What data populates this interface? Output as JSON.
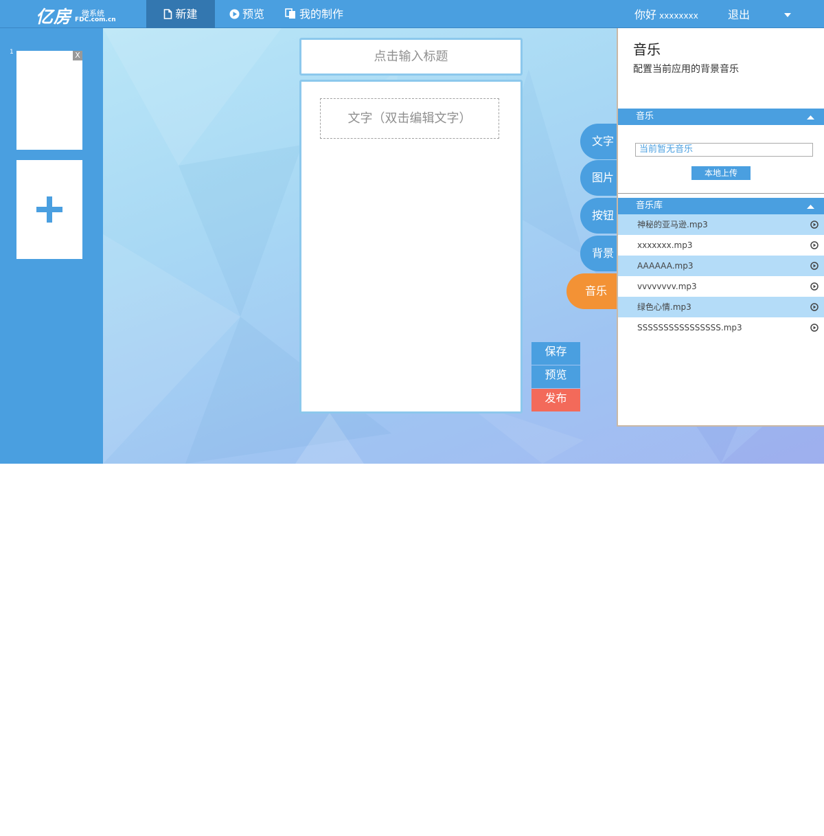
{
  "header": {
    "logo_brand": "亿房",
    "logo_sub": "微系统",
    "logo_domain": "FDC.com.cn",
    "nav": {
      "new": "新建",
      "preview": "预览",
      "mine": "我的制作"
    },
    "greeting": "你好",
    "username": "xxxxxxxx",
    "logout": "退出"
  },
  "pages": {
    "items": [
      {
        "number": "1",
        "close": "X"
      }
    ]
  },
  "editor": {
    "title_placeholder": "点击输入标题",
    "text_element": "文字（双击编辑文字）"
  },
  "tools": {
    "text": "文字",
    "image": "图片",
    "button": "按钮",
    "background": "背景",
    "music": "音乐"
  },
  "actions": {
    "save": "保存",
    "preview": "预览",
    "publish": "发布"
  },
  "panel": {
    "title": "音乐",
    "description": "配置当前应用的背景音乐",
    "music_section": "音乐",
    "current_music": "当前暂无音乐",
    "upload": "本地上传",
    "library_section": "音乐库",
    "library": [
      "神秘的亚马逊.mp3",
      "xxxxxxx.mp3",
      "AAAAAA.mp3",
      "vvvvvvvv.mp3",
      "绿色心情.mp3",
      "SSSSSSSSSSSSSSSS.mp3"
    ]
  },
  "colors": {
    "primary": "#4a9fe0",
    "active_nav": "#3377b0",
    "music_tool": "#f39235",
    "publish": "#f36a5a",
    "list_highlight": "#b4dcf8"
  }
}
